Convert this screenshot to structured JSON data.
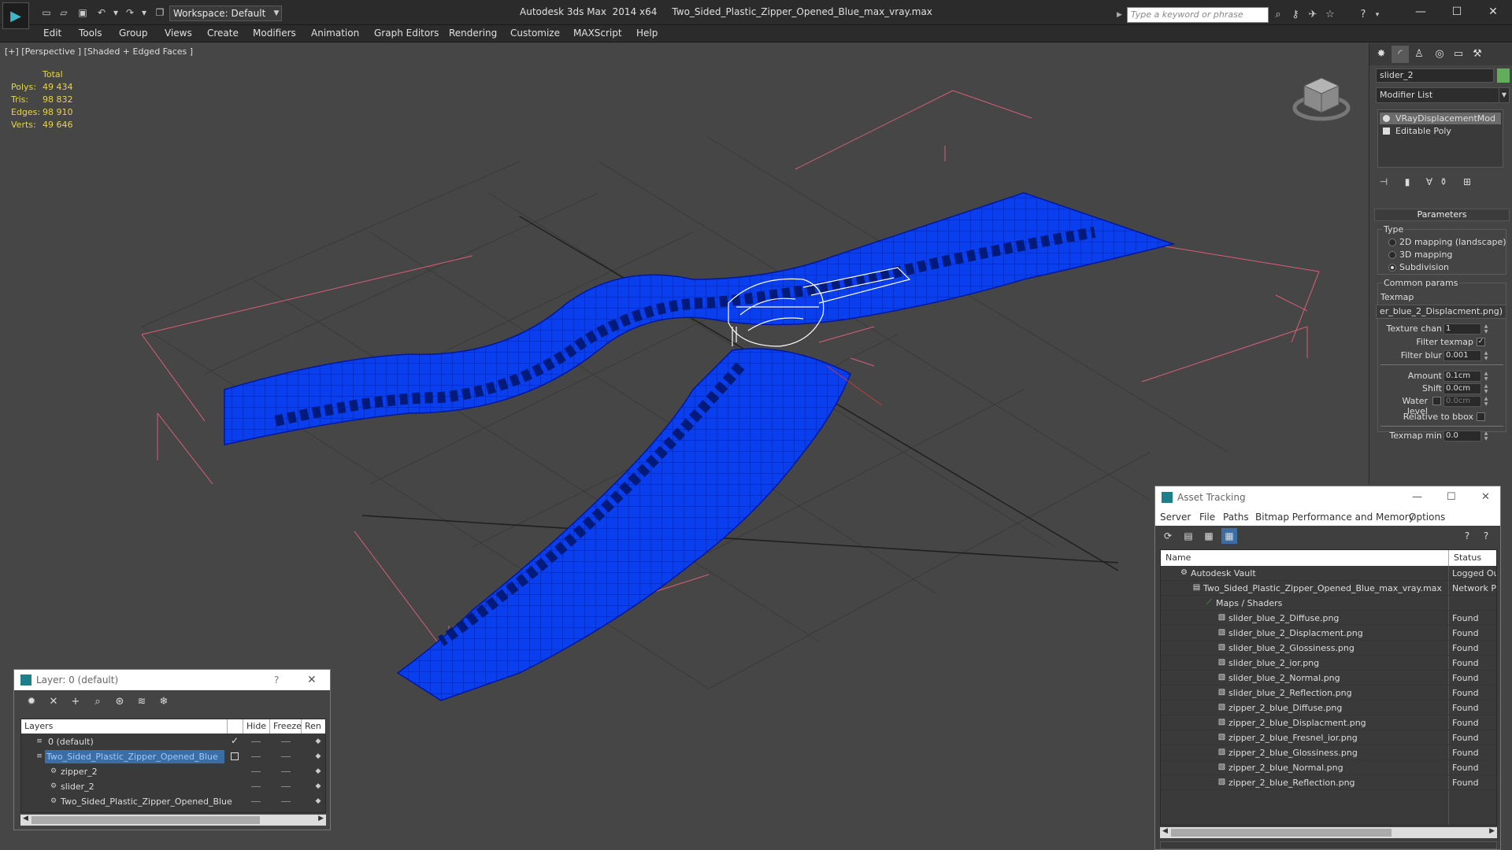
{
  "titlebar": {
    "workspace": "Workspace: Default",
    "app_title": "Autodesk 3ds Max  2014 x64     Two_Sided_Plastic_Zipper_Opened_Blue_max_vray.max",
    "search_placeholder": "Type a keyword or phrase"
  },
  "menubar": [
    "Edit",
    "Tools",
    "Group",
    "Views",
    "Create",
    "Modifiers",
    "Animation",
    "Graph Editors",
    "Rendering",
    "Customize",
    "MAXScript",
    "Help"
  ],
  "viewport": {
    "label": "[+] [Perspective ] [Shaded + Edged Faces ]",
    "stats": {
      "header": "Total",
      "rows": [
        {
          "label": "Polys:",
          "value": "49 434"
        },
        {
          "label": "Tris:",
          "value": "98 832"
        },
        {
          "label": "Edges:",
          "value": "98 910"
        },
        {
          "label": "Verts:",
          "value": "49 646"
        }
      ]
    }
  },
  "command_panel": {
    "object_name": "slider_2",
    "object_color": "#62ad5c",
    "modifier_list": "Modifier List",
    "stack": [
      "VRayDisplacementMod",
      "Editable Poly"
    ],
    "parameters": {
      "rollout": "Parameters",
      "type_label": "Type",
      "types": [
        "2D mapping (landscape)",
        "3D mapping",
        "Subdivision"
      ],
      "selected_type": "Subdivision",
      "common_label": "Common params",
      "texmap_label": "Texmap",
      "texmap": "er_blue_2_Displacment.png)",
      "texture_chan_label": "Texture chan",
      "texture_chan": "1",
      "filter_texmap_label": "Filter texmap",
      "filter_blur_label": "Filter blur",
      "filter_blur": "0.001",
      "amount_label": "Amount",
      "amount": "0.1cm",
      "shift_label": "Shift",
      "shift": "0.0cm",
      "water_label": "Water level",
      "water": "0.0cm",
      "relbbox_label": "Relative to bbox",
      "texmap_min_label": "Texmap min",
      "texmap_min": "0.0"
    }
  },
  "layer_dialog": {
    "title": "Layer: 0 (default)",
    "help": "?",
    "columns": [
      "Layers",
      "Hide",
      "Freeze",
      "Ren"
    ],
    "rows": [
      {
        "name": "0 (default)",
        "level": 0,
        "selected": false
      },
      {
        "name": "Two_Sided_Plastic_Zipper_Opened_Blue",
        "level": 0,
        "selected": true
      },
      {
        "name": "zipper_2",
        "level": 1,
        "selected": false
      },
      {
        "name": "slider_2",
        "level": 1,
        "selected": false
      },
      {
        "name": "Two_Sided_Plastic_Zipper_Opened_Blue",
        "level": 1,
        "selected": false
      }
    ]
  },
  "asset_tracking": {
    "title": "Asset Tracking",
    "menu": [
      "Server",
      "File",
      "Paths",
      "Bitmap Performance and Memory",
      "Options"
    ],
    "columns": [
      "Name",
      "Status"
    ],
    "rows": [
      {
        "name": "Autodesk Vault",
        "level": 1,
        "status": "Logged Ou"
      },
      {
        "name": "Two_Sided_Plastic_Zipper_Opened_Blue_max_vray.max",
        "level": 2,
        "status": "Network Pa"
      },
      {
        "name": "Maps / Shaders",
        "level": 3,
        "status": ""
      },
      {
        "name": "slider_blue_2_Diffuse.png",
        "level": 4,
        "status": "Found"
      },
      {
        "name": "slider_blue_2_Displacment.png",
        "level": 4,
        "status": "Found"
      },
      {
        "name": "slider_blue_2_Glossiness.png",
        "level": 4,
        "status": "Found"
      },
      {
        "name": "slider_blue_2_ior.png",
        "level": 4,
        "status": "Found"
      },
      {
        "name": "slider_blue_2_Normal.png",
        "level": 4,
        "status": "Found"
      },
      {
        "name": "slider_blue_2_Reflection.png",
        "level": 4,
        "status": "Found"
      },
      {
        "name": "zipper_2_blue_Diffuse.png",
        "level": 4,
        "status": "Found"
      },
      {
        "name": "zipper_2_blue_Displacment.png",
        "level": 4,
        "status": "Found"
      },
      {
        "name": "zipper_2_blue_Fresnel_ior.png",
        "level": 4,
        "status": "Found"
      },
      {
        "name": "zipper_2_blue_Glossiness.png",
        "level": 4,
        "status": "Found"
      },
      {
        "name": "zipper_2_blue_Normal.png",
        "level": 4,
        "status": "Found"
      },
      {
        "name": "zipper_2_blue_Reflection.png",
        "level": 4,
        "status": "Found"
      }
    ]
  }
}
